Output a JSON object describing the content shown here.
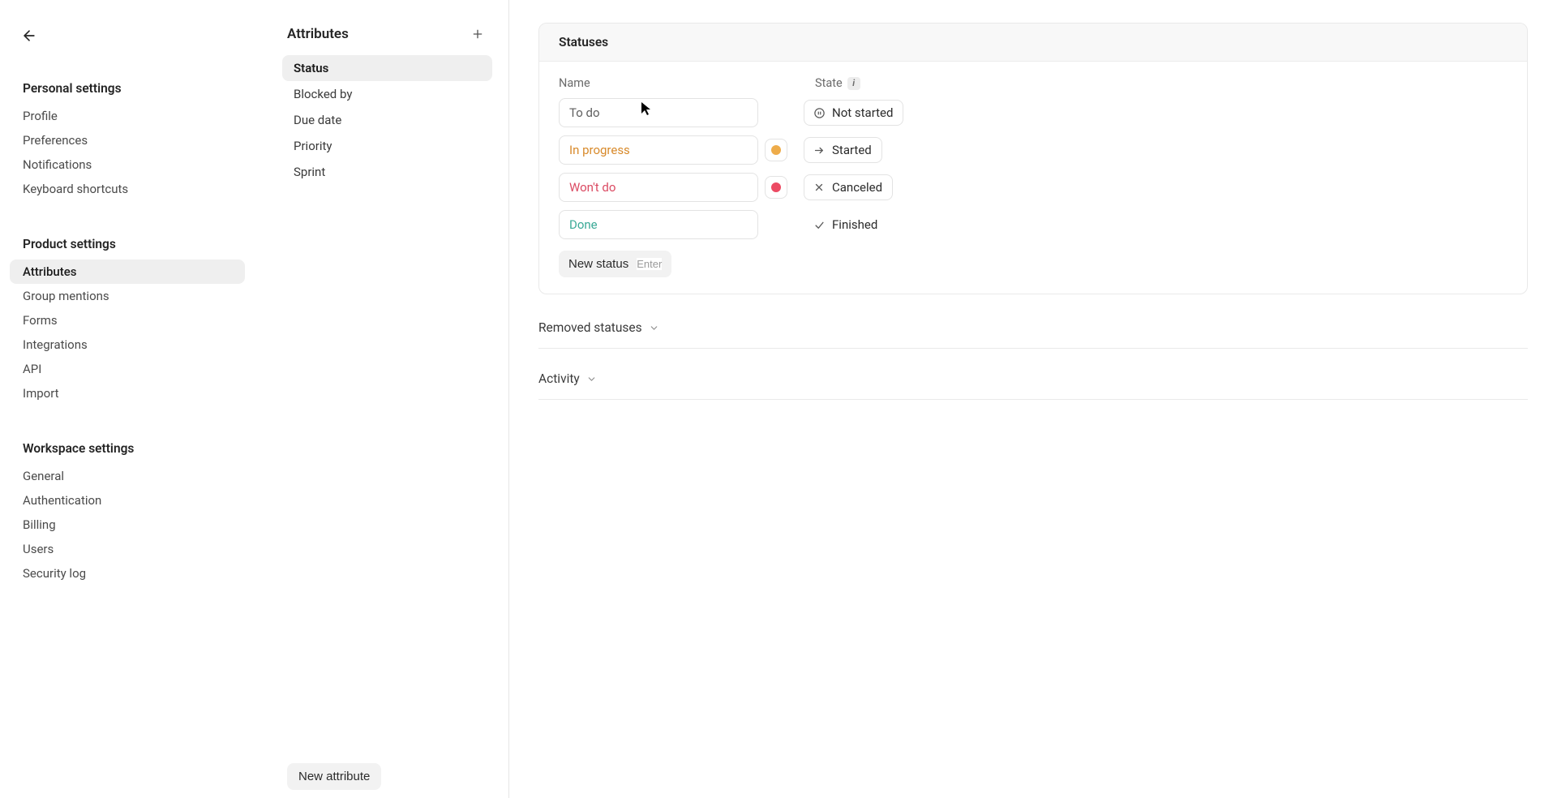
{
  "sidebar": {
    "sections": [
      {
        "heading": "Personal settings",
        "items": [
          "Profile",
          "Preferences",
          "Notifications",
          "Keyboard shortcuts"
        ],
        "active": null
      },
      {
        "heading": "Product settings",
        "items": [
          "Attributes",
          "Group mentions",
          "Forms",
          "Integrations",
          "API",
          "Import"
        ],
        "active": 0
      },
      {
        "heading": "Workspace settings",
        "items": [
          "General",
          "Authentication",
          "Billing",
          "Users",
          "Security log"
        ],
        "active": null
      }
    ]
  },
  "middle": {
    "title": "Attributes",
    "items": [
      "Status",
      "Blocked by",
      "Due date",
      "Priority",
      "Sprint"
    ],
    "active": 0,
    "new_button": "New attribute"
  },
  "main": {
    "card_title": "Statuses",
    "columns": {
      "name": "Name",
      "state": "State"
    },
    "statuses": [
      {
        "name": "To do",
        "color_class": "c-gray",
        "swatch": null,
        "state_icon": "pause",
        "state_label": "Not started",
        "bordered": true
      },
      {
        "name": "In progress",
        "color_class": "c-amber",
        "swatch": "dot-amber",
        "state_icon": "arrow",
        "state_label": "Started",
        "bordered": true
      },
      {
        "name": "Won't do",
        "color_class": "c-red",
        "swatch": "dot-red",
        "state_icon": "x",
        "state_label": "Canceled",
        "bordered": true
      },
      {
        "name": "Done",
        "color_class": "c-teal",
        "swatch": null,
        "state_icon": "check",
        "state_label": "Finished",
        "bordered": false
      }
    ],
    "new_status": {
      "label": "New status",
      "kbd": "Enter"
    },
    "disclosures": [
      {
        "label": "Removed statuses"
      },
      {
        "label": "Activity"
      }
    ]
  }
}
